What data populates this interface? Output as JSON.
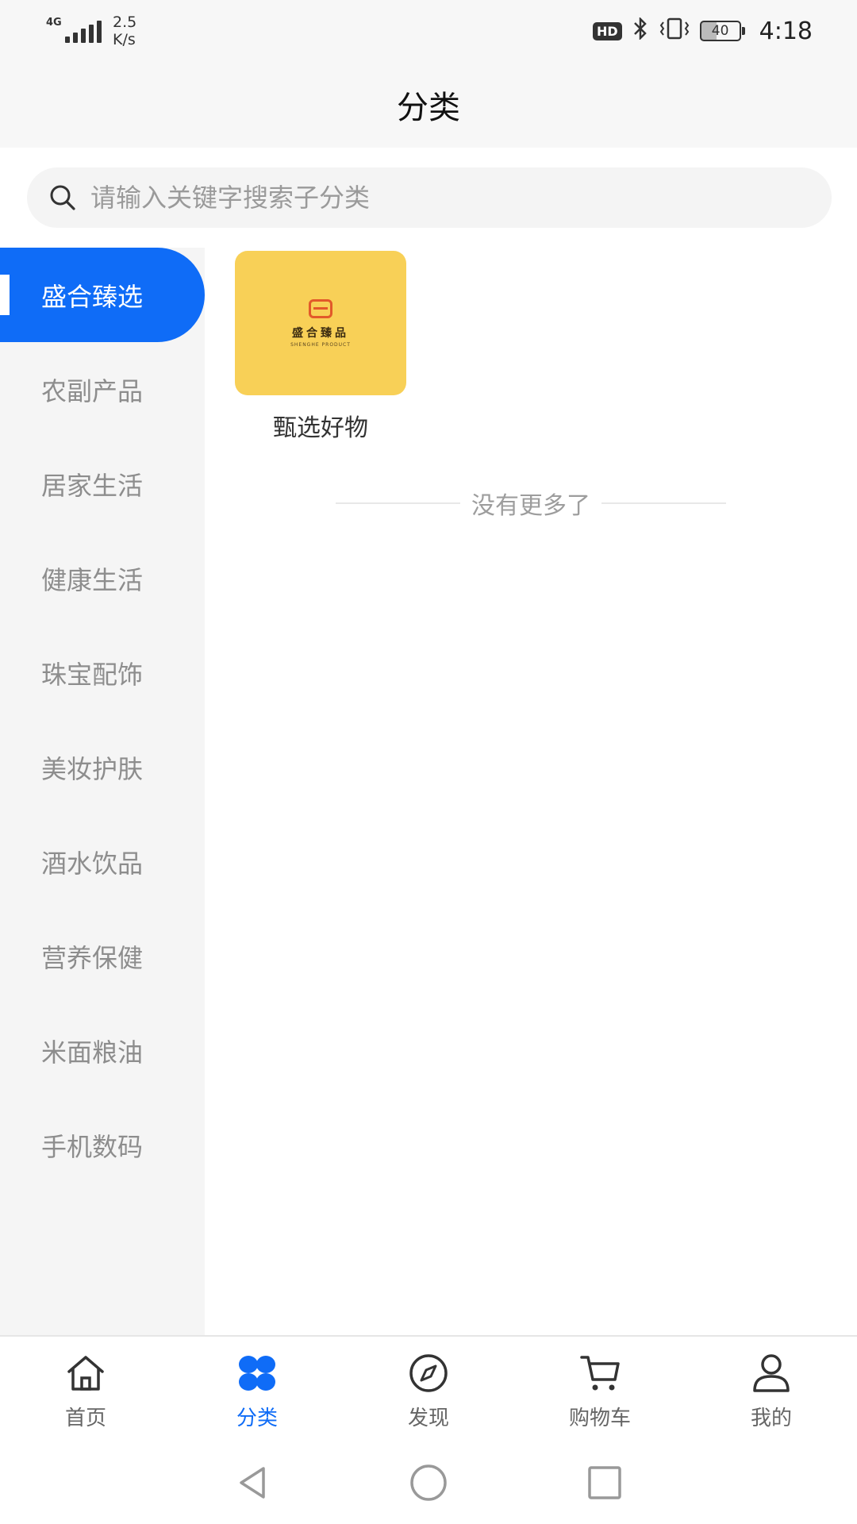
{
  "status_bar": {
    "network": "4G",
    "speed_value": "2.5",
    "speed_unit": "K/s",
    "hd": "HD",
    "battery": "40",
    "time": "4:18"
  },
  "header": {
    "title": "分类"
  },
  "search": {
    "placeholder": "请输入关键字搜索子分类",
    "value": ""
  },
  "sidebar": {
    "items": [
      {
        "label": "盛合臻选",
        "active": true
      },
      {
        "label": "农副产品"
      },
      {
        "label": "居家生活"
      },
      {
        "label": "健康生活"
      },
      {
        "label": "珠宝配饰"
      },
      {
        "label": "美妆护肤"
      },
      {
        "label": "酒水饮品"
      },
      {
        "label": "营养保健"
      },
      {
        "label": "米面粮油"
      },
      {
        "label": "手机数码"
      }
    ]
  },
  "content": {
    "categories": [
      {
        "label": "甄选好物",
        "logo_text": "盛合臻品",
        "logo_sub": "SHENGHE PRODUCT"
      }
    ],
    "end_text": "没有更多了"
  },
  "tabbar": {
    "tabs": [
      {
        "label": "首页",
        "icon": "home-icon"
      },
      {
        "label": "分类",
        "icon": "category-icon",
        "active": true
      },
      {
        "label": "发现",
        "icon": "compass-icon"
      },
      {
        "label": "购物车",
        "icon": "cart-icon"
      },
      {
        "label": "我的",
        "icon": "profile-icon"
      }
    ]
  },
  "colors": {
    "accent": "#0f6cf7",
    "thumb_bg": "#f8d057",
    "sidebar_bg": "#f5f5f5"
  }
}
